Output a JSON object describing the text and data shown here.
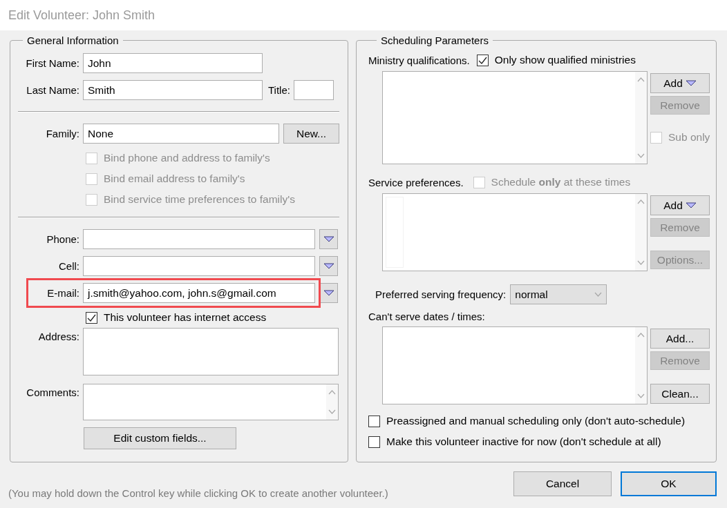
{
  "window": {
    "title": "Edit Volunteer: John Smith"
  },
  "general_information": {
    "title": "General Information",
    "first_name": {
      "label": "First Name:",
      "value": "John"
    },
    "last_name": {
      "label": "Last Name:",
      "value": "Smith"
    },
    "title_field": {
      "label": "Title:"
    },
    "family": {
      "label": "Family:",
      "value": "None",
      "button": "New..."
    },
    "family_bindings": [
      {
        "label": "Bind phone and address to family's",
        "checked": false,
        "disabled": true
      },
      {
        "label": "Bind email address to family's",
        "checked": false,
        "disabled": true
      },
      {
        "label": "Bind service time preferences to family's",
        "checked": false,
        "disabled": true
      }
    ],
    "contact_fields": [
      {
        "label": "Phone:",
        "highlighted": false
      },
      {
        "label": "Cell:",
        "highlighted": false
      },
      {
        "label": "E-mail:",
        "value": "j.smith@yahoo.com, john.s@gmail.com",
        "highlighted": true
      }
    ],
    "internet_access": {
      "label": "This volunteer has internet access",
      "checked": true,
      "disabled": false
    },
    "address": {
      "label": "Address:"
    },
    "comments": {
      "label": "Comments:"
    },
    "custom_fields_button": "Edit custom fields..."
  },
  "scheduling_parameters": {
    "title": "Scheduling Parameters",
    "ministry": {
      "label": "Ministry qualifications.",
      "filter": {
        "label": "Only show qualified ministries",
        "checked": true,
        "disabled": false
      },
      "buttons": [
        {
          "label": "Add",
          "kind": "dropdown",
          "disabled": false
        },
        {
          "label": "Remove",
          "kind": "plain",
          "disabled": true
        }
      ],
      "sub_only": {
        "label": "Sub only",
        "checked": false,
        "disabled": true
      }
    },
    "service": {
      "label": "Service preferences.",
      "filter": {
        "label": "Schedule **only** at these times",
        "checked": false,
        "disabled": true
      },
      "buttons": [
        {
          "label": "Add",
          "kind": "dropdown",
          "disabled": false
        },
        {
          "label": "Remove",
          "kind": "plain",
          "disabled": true
        },
        {
          "label": "Options...",
          "kind": "plain",
          "disabled": true
        }
      ]
    },
    "frequency": {
      "label": "Preferred serving frequency:",
      "value": "normal"
    },
    "cant_serve": {
      "label": "Can't serve dates / times:",
      "buttons": [
        {
          "label": "Add...",
          "kind": "plain",
          "disabled": false
        },
        {
          "label": "Remove",
          "kind": "plain",
          "disabled": true
        },
        {
          "label": "Clean...",
          "kind": "plain",
          "disabled": false
        }
      ]
    },
    "options": [
      {
        "label": "Preassigned and manual scheduling only (don't auto-schedule)",
        "checked": false,
        "disabled": false
      },
      {
        "label": "Make this volunteer inactive for now (don't schedule at all)",
        "checked": false,
        "disabled": false
      }
    ]
  },
  "footer": {
    "hint": "(You may hold down the Control key while clicking OK to create another volunteer.)",
    "buttons": [
      {
        "label": "Cancel",
        "default": false
      },
      {
        "label": "OK",
        "default": true
      }
    ]
  }
}
